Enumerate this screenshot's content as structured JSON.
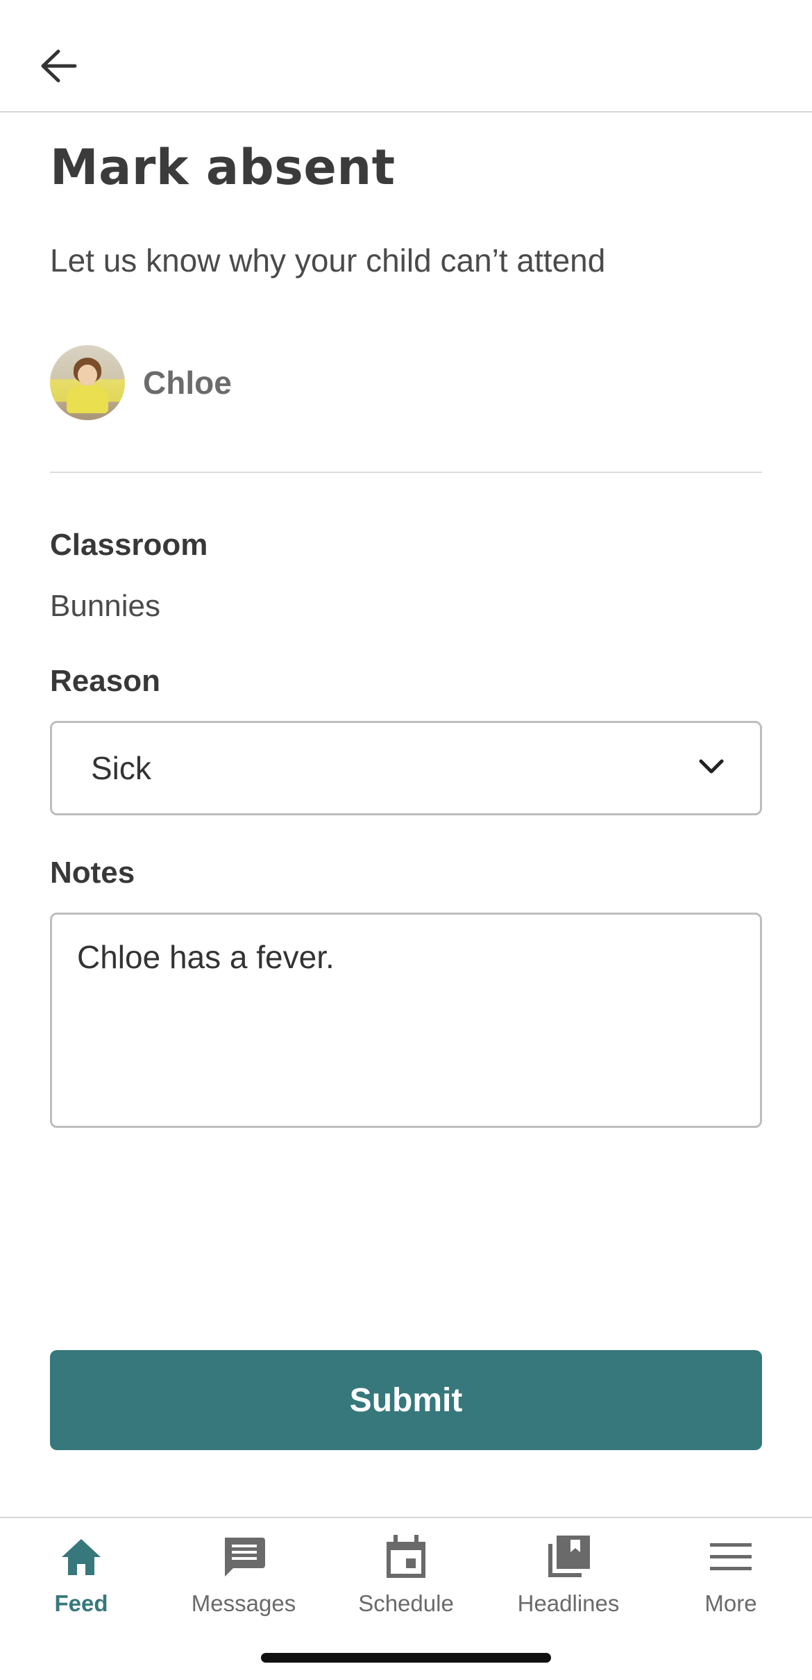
{
  "header": {
    "back_icon": "arrow-left-icon"
  },
  "page": {
    "title": "Mark absent",
    "subtitle": "Let us know why your child can’t attend"
  },
  "child": {
    "name": "Chloe",
    "avatar_icon": "child-avatar"
  },
  "form": {
    "classroom_label": "Classroom",
    "classroom_value": "Bunnies",
    "reason_label": "Reason",
    "reason_value": "Sick",
    "notes_label": "Notes",
    "notes_value": "Chloe has a fever.",
    "submit_label": "Submit"
  },
  "nav": {
    "items": [
      {
        "label": "Feed",
        "icon": "home-icon",
        "active": true
      },
      {
        "label": "Messages",
        "icon": "message-icon",
        "active": false
      },
      {
        "label": "Schedule",
        "icon": "calendar-icon",
        "active": false
      },
      {
        "label": "Headlines",
        "icon": "headlines-icon",
        "active": false
      },
      {
        "label": "More",
        "icon": "menu-icon",
        "active": false
      }
    ]
  },
  "colors": {
    "accent": "#36787c",
    "text": "#3a3a3a",
    "muted": "#6a6a6a",
    "border": "#bdbdbd"
  }
}
